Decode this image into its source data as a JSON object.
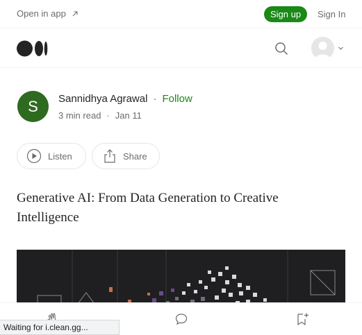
{
  "topbar": {
    "open_in_app": "Open in app",
    "sign_up": "Sign up",
    "sign_in": "Sign In"
  },
  "navbar": {
    "logo_icon": "medium-logo-icon",
    "search_icon": "search-icon",
    "avatar_icon": "user-avatar-icon"
  },
  "author": {
    "initial": "S",
    "name": "Sannidhya Agrawal",
    "separator": "·",
    "follow": "Follow",
    "read_time": "3 min read",
    "date": "Jan 11"
  },
  "actions": {
    "listen": "Listen",
    "share": "Share"
  },
  "article": {
    "title": "Generative AI: From Data Generation to Creative Intelligence"
  },
  "bottombar": {
    "clap_icon": "clap-icon",
    "comment_icon": "comment-icon",
    "bookmark_icon": "bookmark-add-icon"
  },
  "status": {
    "text": "Waiting for i.clean.gg..."
  },
  "colors": {
    "accent_green": "#1a8917",
    "avatar_green": "#2e6a20",
    "hero_background": "#1f1f21"
  }
}
